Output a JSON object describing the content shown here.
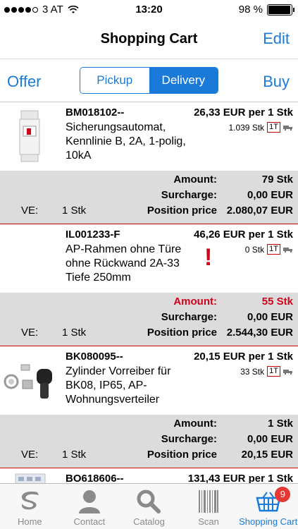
{
  "status": {
    "carrier": "3 AT",
    "time": "13:20",
    "battery_text": "98 %",
    "battery_level": 0.98
  },
  "nav": {
    "title": "Shopping Cart",
    "edit": "Edit"
  },
  "toolbar": {
    "offer": "Offer",
    "buy": "Buy",
    "segments": [
      "Pickup",
      "Delivery"
    ],
    "active_segment": "Delivery"
  },
  "items": [
    {
      "sku": "BM018102--",
      "price": "26,33 EUR per 1 Stk",
      "desc": "Sicherungsautomat, Kennlinie B, 2A, 1-polig, 10kA",
      "stock": "1.039 Stk",
      "stock_code": "1T",
      "warning": "",
      "summary": {
        "amount_label": "Amount:",
        "amount": "79 Stk",
        "amount_warn": false,
        "surcharge_label": "Surcharge:",
        "surcharge": "0,00 EUR",
        "ve_label": "VE:",
        "ve": "1 Stk",
        "position_label": "Position price",
        "position": "2.080,07 EUR"
      }
    },
    {
      "sku": "IL001233-F",
      "price": "46,26 EUR per 1 Stk",
      "desc": "AP-Rahmen ohne Türe ohne Rückwand 2A-33 Tiefe 250mm",
      "stock": "0 Stk",
      "stock_code": "1T",
      "warning": "!",
      "summary": {
        "amount_label": "Amount:",
        "amount": "55 Stk",
        "amount_warn": true,
        "surcharge_label": "Surcharge:",
        "surcharge": "0,00 EUR",
        "ve_label": "VE:",
        "ve": "1 Stk",
        "position_label": "Position price",
        "position": "2.544,30 EUR"
      }
    },
    {
      "sku": "BK080095--",
      "price": "20,15 EUR per 1 Stk",
      "desc": "Zylinder Vorreiber für BK08, IP65, AP-Wohnungsverteiler",
      "stock": "33 Stk",
      "stock_code": "1T",
      "warning": "",
      "summary": {
        "amount_label": "Amount:",
        "amount": "1 Stk",
        "amount_warn": false,
        "surcharge_label": "Surcharge:",
        "surcharge": "0,00 EUR",
        "ve_label": "VE:",
        "ve": "1 Stk",
        "position_label": "Position price",
        "position": "20,15 EUR"
      }
    },
    {
      "sku": "BO618606--",
      "price": "131,43 EUR per 1 Stk",
      "desc": "",
      "stock": "",
      "stock_code": "",
      "warning": ""
    }
  ],
  "tabs": [
    {
      "label": "Home",
      "icon": "home-logo-icon"
    },
    {
      "label": "Contact",
      "icon": "person-icon"
    },
    {
      "label": "Catalog",
      "icon": "magnifier-icon"
    },
    {
      "label": "Scan",
      "icon": "barcode-icon"
    },
    {
      "label": "Shopping Cart",
      "icon": "basket-icon",
      "badge": "9",
      "active": true
    }
  ],
  "colors": {
    "accent": "#1a7ad8",
    "warning": "#d0021b",
    "summary_bg": "#dcdcdc"
  }
}
